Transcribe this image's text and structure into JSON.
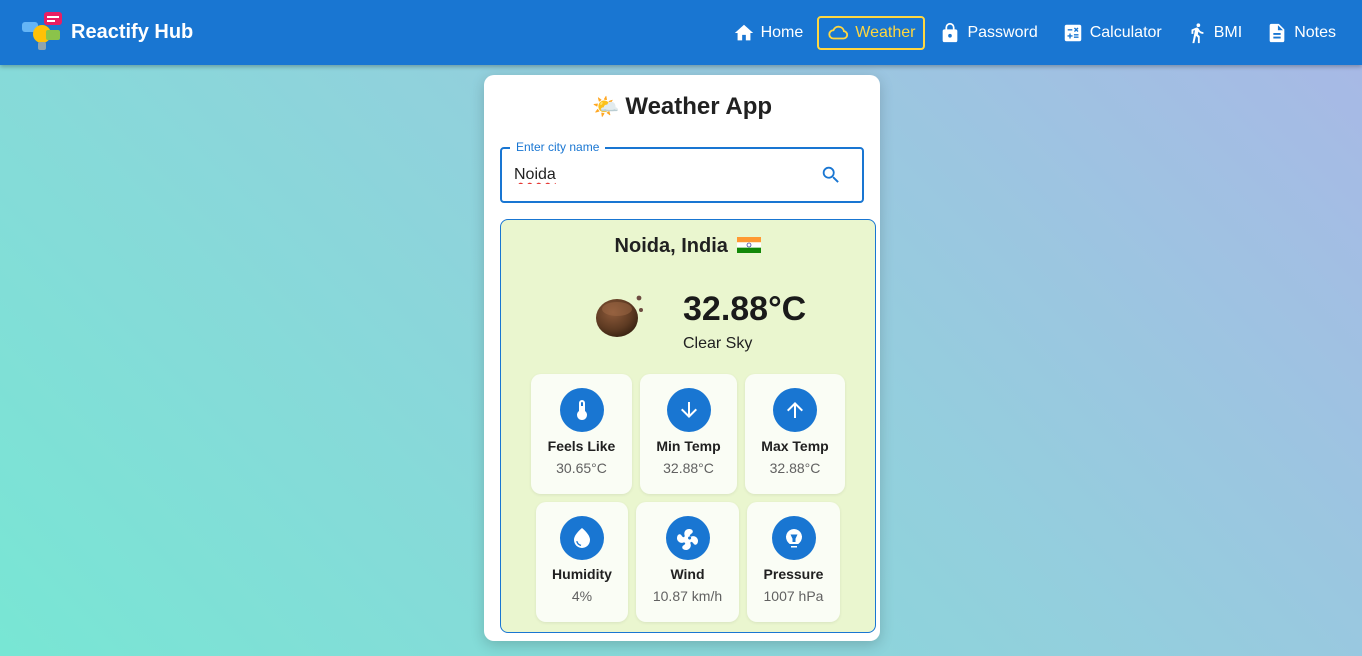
{
  "app": {
    "name": "Reactify Hub"
  },
  "nav": {
    "items": [
      {
        "label": "Home",
        "icon": "home-icon",
        "active": false
      },
      {
        "label": "Weather",
        "icon": "cloud-icon",
        "active": true
      },
      {
        "label": "Password",
        "icon": "lock-icon",
        "active": false
      },
      {
        "label": "Calculator",
        "icon": "calculator-icon",
        "active": false
      },
      {
        "label": "BMI",
        "icon": "walk-icon",
        "active": false
      },
      {
        "label": "Notes",
        "icon": "note-icon",
        "active": false
      }
    ]
  },
  "weather": {
    "title": "Weather App",
    "title_icon": "🌤️",
    "search": {
      "label": "Enter city name",
      "value": "Noida"
    },
    "location": "Noida, India",
    "flag": "india-flag",
    "temperature": "32.88°C",
    "condition": "Clear Sky",
    "stats": [
      {
        "label": "Feels Like",
        "value": "30.65°C",
        "icon": "thermometer-icon"
      },
      {
        "label": "Min Temp",
        "value": "32.88°C",
        "icon": "arrow-down-icon"
      },
      {
        "label": "Max Temp",
        "value": "32.88°C",
        "icon": "arrow-up-icon"
      },
      {
        "label": "Humidity",
        "value": "4%",
        "icon": "water-drop-icon"
      },
      {
        "label": "Wind",
        "value": "10.87 km/h",
        "icon": "wind-icon"
      },
      {
        "label": "Pressure",
        "value": "1007 hPa",
        "icon": "pressure-icon"
      }
    ]
  },
  "colors": {
    "primary": "#1976d2",
    "active_nav": "#ffd740",
    "result_bg": "#eaf6cf"
  }
}
